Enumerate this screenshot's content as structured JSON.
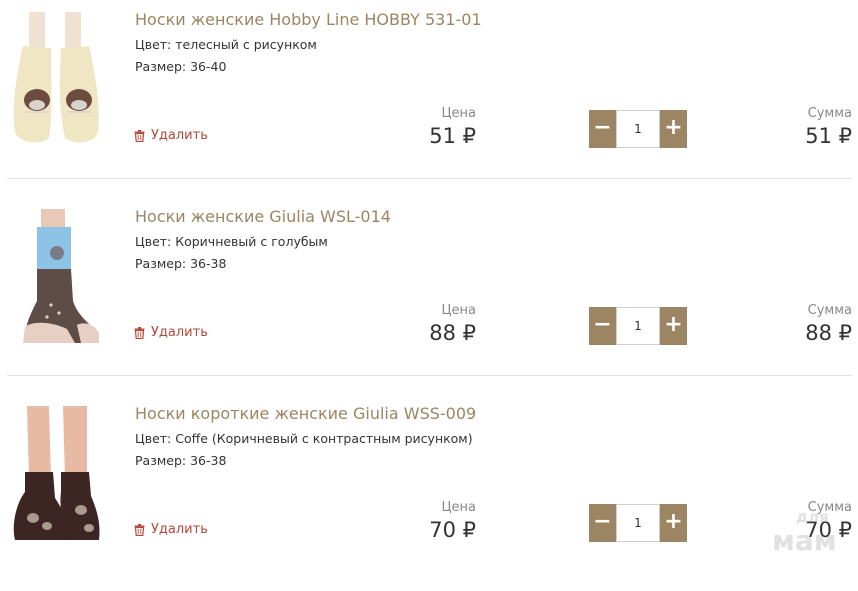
{
  "cart": {
    "items": [
      {
        "title": "Носки женские Hobby Line HOBBY 531-01",
        "color": "Цвет: телесный с рисунком",
        "size": "Размер: 36-40",
        "remove_label": "Удалить",
        "price_label": "Цена",
        "price": "51 ₽",
        "quantity": "1",
        "sum_label": "Сумма",
        "sum": "51 ₽"
      },
      {
        "title": "Носки женские Giulia WSL-014",
        "color": "Цвет: Коричневый с голубым",
        "size": "Размер: 36-38",
        "remove_label": "Удалить",
        "price_label": "Цена",
        "price": "88 ₽",
        "quantity": "1",
        "sum_label": "Сумма",
        "sum": "88 ₽"
      },
      {
        "title": "Носки короткие женские Giulia WSS-009",
        "color": "Цвет: Coffe (Коричневый с контрастным рисунком)",
        "size": "Размер: 36-38",
        "remove_label": "Удалить",
        "price_label": "Цена",
        "price": "70 ₽",
        "quantity": "1",
        "sum_label": "Сумма",
        "sum": "70 ₽"
      }
    ],
    "quantity_minus_symbol": "−",
    "quantity_plus_symbol": "+",
    "remove_icon": "trash-icon"
  },
  "watermark": {
    "text_top": "для",
    "text_bottom": "мам"
  },
  "colors": {
    "accent": "#9c8563",
    "remove": "#b5473a",
    "divider": "#e2e2e2"
  }
}
